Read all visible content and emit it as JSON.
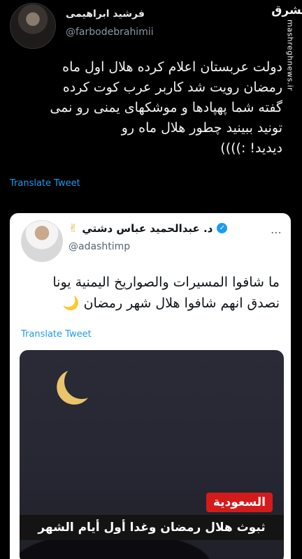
{
  "tweet": {
    "author_name": "فرشید ابراهیمی",
    "author_handle": "@farbodebrahimii",
    "body_lines": [
      "دولت عربستان اعلام کرده هلال اول ماه",
      "رمضان رویت شد کاربر عرب کوت کرده",
      "گفته شما پهپادها و موشکهای یمنی رو نمی",
      "تونید ببینید چطور هلال ماه رو",
      "دیدید! :))))"
    ],
    "translate_label": "Translate Tweet"
  },
  "watermark": {
    "logo_text": "مشرق",
    "site_text": "mashreghnews.ir"
  },
  "quoted_tweet": {
    "author_name": "د. عبدالحميد عباس دشتي",
    "author_handle": "@adashtimp",
    "victory_emoji": "✌",
    "verified_glyph": "✓",
    "more_glyph": "⋯",
    "body_lines": [
      "ما شافوا المسيرات والصواريخ اليمنية يونا",
      "نصدق انهم شافوا هلال شهر رمضان 🌙"
    ],
    "translate_label": "Translate Tweet",
    "media": {
      "badge_text": "السعودية",
      "caption_text": "ثبوث هلال رمضان وغدا أول أيام الشهر",
      "badge_color": "#d41b1b",
      "moon_color": "#e9c46a"
    }
  },
  "colors": {
    "background": "#000000",
    "link": "#1d9bf0",
    "secondary_text": "#8b98a5"
  }
}
